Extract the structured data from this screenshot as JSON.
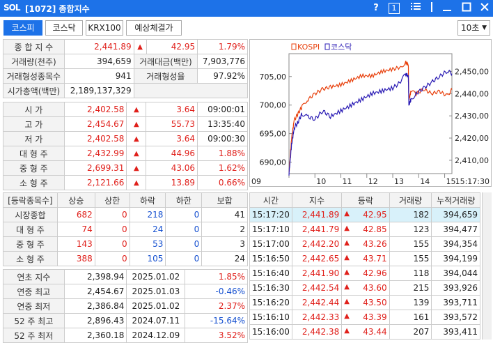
{
  "window": {
    "logo": "SOL",
    "title": "[1072] 종합지수",
    "help": "?",
    "badge": "1"
  },
  "tabs": [
    "코스피",
    "코스닥",
    "KRX100",
    "예상체결가"
  ],
  "interval": "10초",
  "summary": {
    "rows": [
      [
        "종 합 지 수",
        "2,441.89",
        "▲",
        "42.95",
        "1.79%"
      ],
      [
        "거래량(천주)",
        "394,659",
        "거래대금(백만)",
        "7,903,776"
      ],
      [
        "거래형성종목수",
        "941",
        "거래형성율",
        "97.92%"
      ],
      [
        "시가총액(백만)",
        "2,189,137,329"
      ]
    ]
  },
  "prices": [
    [
      "시 가",
      "2,402.58",
      "▲",
      "3.64",
      "09:00:01"
    ],
    [
      "고 가",
      "2,454.67",
      "▲",
      "55.73",
      "13:35:40"
    ],
    [
      "저 가",
      "2,402.58",
      "▲",
      "3.64",
      "09:00:30"
    ],
    [
      "대 형 주",
      "2,432.99",
      "▲",
      "44.96",
      "1.88%"
    ],
    [
      "중 형 주",
      "2,699.31",
      "▲",
      "43.06",
      "1.62%"
    ],
    [
      "소 형 주",
      "2,121.66",
      "▲",
      "13.89",
      "0.66%"
    ]
  ],
  "breadth": {
    "headers": [
      "[등락종목수]",
      "상승",
      "상한",
      "하락",
      "하한",
      "보합"
    ],
    "rows": [
      [
        "시장종합",
        "682",
        "0",
        "218",
        "0",
        "41"
      ],
      [
        "대 형 주",
        "74",
        "0",
        "24",
        "0",
        "2"
      ],
      [
        "중 형 주",
        "143",
        "0",
        "53",
        "0",
        "3"
      ],
      [
        "소 형 주",
        "388",
        "0",
        "105",
        "0",
        "24"
      ]
    ]
  },
  "history": [
    [
      "연초 지수",
      "2,398.94",
      "2025.01.02",
      "1.85%"
    ],
    [
      "연중 최고",
      "2,454.67",
      "2025.01.03",
      "-0.46%"
    ],
    [
      "연중 최저",
      "2,386.84",
      "2025.01.02",
      "2.37%"
    ],
    [
      "52 주 최고",
      "2,896.43",
      "2024.07.11",
      "-15.64%"
    ],
    [
      "52 주 최저",
      "2,360.18",
      "2024.12.09",
      "3.52%"
    ]
  ],
  "ticks": {
    "headers": [
      "시간",
      "지수",
      "등락",
      "거래량",
      "누적거래량"
    ],
    "rows": [
      [
        "15:17:20",
        "2,441.89",
        "▲",
        "42.95",
        "182",
        "394,659"
      ],
      [
        "15:17:10",
        "2,441.79",
        "▲",
        "42.85",
        "123",
        "394,477"
      ],
      [
        "15:17:00",
        "2,442.20",
        "▲",
        "43.26",
        "155",
        "394,354"
      ],
      [
        "15:16:50",
        "2,442.65",
        "▲",
        "43.71",
        "155",
        "394,199"
      ],
      [
        "15:16:40",
        "2,441.90",
        "▲",
        "42.96",
        "118",
        "394,044"
      ],
      [
        "15:16:30",
        "2,442.54",
        "▲",
        "43.60",
        "215",
        "393,926"
      ],
      [
        "15:16:20",
        "2,442.44",
        "▲",
        "43.50",
        "139",
        "393,711"
      ],
      [
        "15:16:10",
        "2,442.33",
        "▲",
        "43.39",
        "161",
        "393,572"
      ],
      [
        "15:16:00",
        "2,442.38",
        "▲",
        "43.44",
        "207",
        "393,411"
      ]
    ]
  },
  "chart_data": {
    "type": "line",
    "legend": [
      "KOSPI",
      "코스닥"
    ],
    "colors": {
      "KOSPI": "#e8400c",
      "코스닥": "#2a1bb4"
    },
    "left_axis": {
      "ticks": [
        "705,00",
        "700,00",
        "695,00",
        "690,00"
      ],
      "range": [
        688,
        709
      ]
    },
    "right_axis": {
      "ticks": [
        "2,450,00",
        "2,440,00",
        "2,430,00",
        "2,420,00",
        "2,410,00"
      ],
      "range": [
        2404,
        2458
      ]
    },
    "x_ticks": [
      "09",
      "10",
      "11",
      "12",
      "13",
      "14",
      "15"
    ],
    "last_time": "15:17:30",
    "series": [
      {
        "name": "KOSPI",
        "axis": "right",
        "x": [
          9.0,
          9.1,
          9.2,
          9.35,
          9.5,
          9.7,
          10.0,
          10.3,
          10.6,
          11.0,
          11.4,
          11.8,
          12.2,
          12.6,
          13.0,
          13.3,
          13.5,
          13.6,
          13.62,
          13.7,
          13.9,
          14.2,
          14.5,
          14.8,
          15.1,
          15.28
        ],
        "y": [
          2404,
          2420,
          2428,
          2431,
          2434,
          2437,
          2440,
          2442,
          2443,
          2444,
          2446,
          2448,
          2448,
          2450,
          2451,
          2452,
          2454,
          2453,
          2437,
          2441,
          2440,
          2442,
          2440,
          2441,
          2439,
          2441.9
        ]
      },
      {
        "name": "코스닥",
        "axis": "left",
        "x": [
          9.0,
          9.1,
          9.2,
          9.35,
          9.5,
          9.7,
          10.0,
          10.3,
          10.6,
          11.0,
          11.4,
          11.8,
          12.2,
          12.6,
          13.0,
          13.3,
          13.5,
          13.6,
          13.62,
          13.7,
          13.9,
          14.2,
          14.5,
          14.8,
          15.1,
          15.28
        ],
        "y": [
          688,
          693,
          696,
          697,
          698.5,
          698,
          697.5,
          699,
          698,
          699,
          700,
          701,
          702,
          702.5,
          703,
          704,
          705.5,
          705,
          700,
          701,
          702,
          703,
          704,
          705,
          706,
          705.5
        ]
      }
    ]
  }
}
